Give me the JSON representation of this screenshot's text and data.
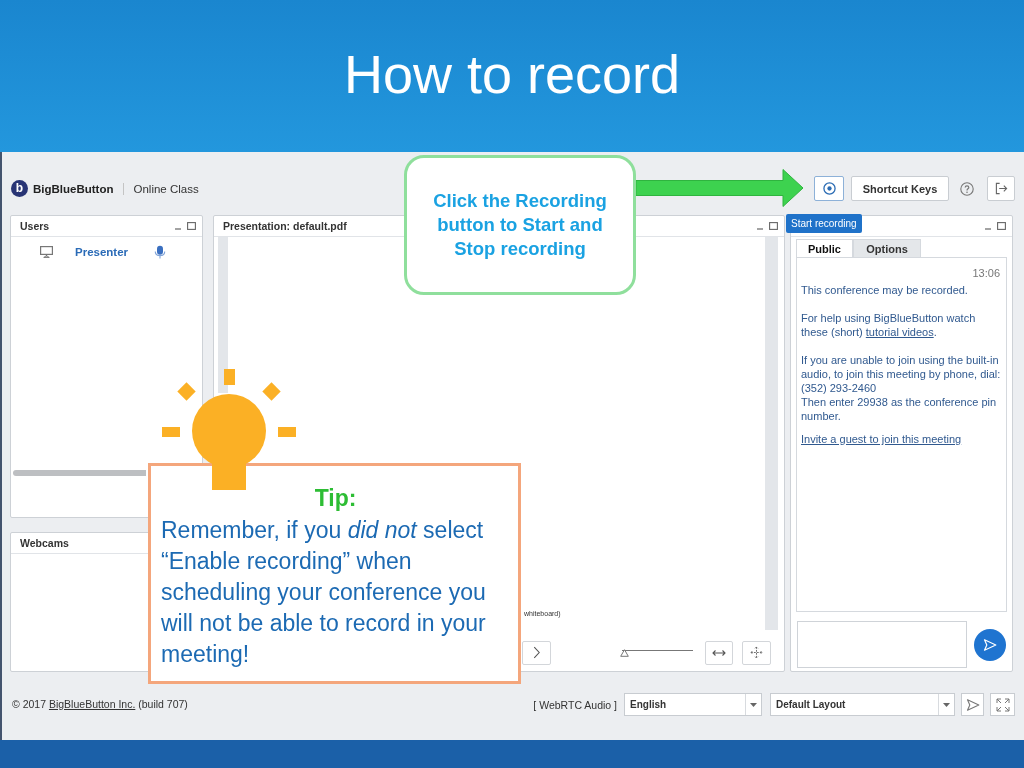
{
  "slide": {
    "title": "How to record"
  },
  "app": {
    "brand": {
      "logo_letter": "b",
      "name": "BigBlueButton",
      "meeting": "Online Class"
    },
    "toolbar": {
      "shortcut_keys": "Shortcut Keys"
    },
    "tooltip": "Start recording",
    "users_panel": {
      "title": "Users",
      "users": [
        {
          "name": "Presenter",
          "presenter": true,
          "audio": true
        }
      ]
    },
    "webcams_panel": {
      "title": "Webcams"
    },
    "presentation_panel": {
      "title": "Presentation: default.pdf",
      "slide_text": "whiteboard)",
      "zoom": {
        "level": 0
      }
    },
    "chat_panel": {
      "tabs": [
        {
          "label": "Public",
          "selected": true
        },
        {
          "label": "Options",
          "selected": false
        }
      ],
      "time": "13:06",
      "messages": [
        {
          "kind": "text",
          "text": "This conference may be recorded."
        },
        {
          "kind": "text_link",
          "text": "For help using BigBlueButton watch these (short) ",
          "link": "tutorial videos",
          "after": "."
        },
        {
          "kind": "lines",
          "lines": [
            "If you are unable to join using the built-in",
            "audio, to join this meeting by phone, dial:",
            "(352) 293-2460",
            "Then enter 29938 as the conference pin",
            "number."
          ]
        },
        {
          "kind": "link",
          "text": "Invite a guest to join this meeting"
        }
      ]
    },
    "footer": {
      "copyright": {
        "prefix": "© 2017 ",
        "link": "BigBlueButton Inc.",
        "suffix": " (build 707)"
      },
      "audio": "[ WebRTC Audio ]",
      "language": "English",
      "layout": "Default Layout"
    }
  },
  "callout": {
    "text": "Click the Recording button to Start and Stop recording"
  },
  "tip": {
    "heading": "Tip:",
    "lines": [
      "Remember, if you *did not* select",
      "“Enable recording” when",
      "scheduling your conference you",
      "will not be able to record in your",
      "meeting!"
    ]
  }
}
